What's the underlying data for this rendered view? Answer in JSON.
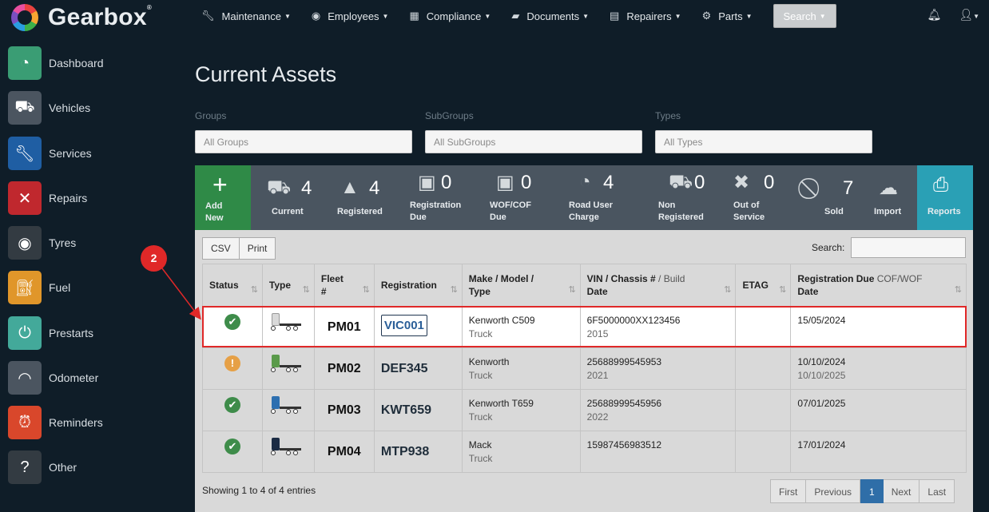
{
  "brand": {
    "name": "Gearbox"
  },
  "sidebar": {
    "items": [
      {
        "label": "Dashboard",
        "icon": "speedometer-icon",
        "color": "#3a9d74"
      },
      {
        "label": "Vehicles",
        "icon": "truck-icon",
        "color": "#4b5560"
      },
      {
        "label": "Services",
        "icon": "wrench-icon",
        "color": "#1f5ea3"
      },
      {
        "label": "Repairs",
        "icon": "tools-icon",
        "color": "#c0282e"
      },
      {
        "label": "Tyres",
        "icon": "tyre-icon",
        "color": "#333b42"
      },
      {
        "label": "Fuel",
        "icon": "fuel-pump-icon",
        "color": "#e0962a"
      },
      {
        "label": "Prestarts",
        "icon": "power-icon",
        "color": "#43a99a"
      },
      {
        "label": "Odometer",
        "icon": "gauge-icon",
        "color": "#4b5560"
      },
      {
        "label": "Reminders",
        "icon": "alarm-clock-icon",
        "color": "#d9472b"
      },
      {
        "label": "Other",
        "icon": "question-icon",
        "color": "#333b42"
      }
    ]
  },
  "topnav": {
    "menus": [
      {
        "label": "Maintenance",
        "icon": "wrench-icon"
      },
      {
        "label": "Employees",
        "icon": "user-circle-icon"
      },
      {
        "label": "Compliance",
        "icon": "calendar-icon"
      },
      {
        "label": "Documents",
        "icon": "folder-icon"
      },
      {
        "label": "Repairers",
        "icon": "address-book-icon"
      },
      {
        "label": "Parts",
        "icon": "gear-icon"
      }
    ],
    "search_label": "Search"
  },
  "page": {
    "title": "Current Assets"
  },
  "filters": [
    {
      "label": "Groups",
      "value": "All Groups"
    },
    {
      "label": "SubGroups",
      "value": "All SubGroups"
    },
    {
      "label": "Types",
      "value": "All Types"
    }
  ],
  "stats": {
    "add_label": "Add New",
    "items": [
      {
        "count": "4",
        "label": "Current"
      },
      {
        "count": "4",
        "label": "Registered"
      },
      {
        "count": "0",
        "label": "Registration Due"
      },
      {
        "count": "0",
        "label": "WOF/COF Due"
      },
      {
        "count": "4",
        "label": "Road User Charge"
      },
      {
        "count": "0",
        "label": "Non Registered"
      },
      {
        "count": "0",
        "label": "Out of Service"
      },
      {
        "count": "7",
        "label": "Sold"
      }
    ],
    "import_label": "Import",
    "reports_label": "Reports"
  },
  "table_tools": {
    "csv": "CSV",
    "print": "Print",
    "search_label": "Search:"
  },
  "table": {
    "headers": {
      "status": "Status",
      "type": "Type",
      "fleet": "Fleet #",
      "registration": "Registration",
      "make": "Make / Model / Type",
      "vin_a": "VIN / Chassis #",
      "vin_b": " / Build",
      "vin_c": "Date",
      "etag": "ETAG",
      "regdue_a": "Registration Due",
      "regdue_b": " COF/WOF",
      "regdue_c": "Date"
    },
    "rows": [
      {
        "status": "ok",
        "fleet": "PM01",
        "registration": "VIC001",
        "make": "Kenworth C509",
        "type": "Truck",
        "vin": "6F5000000XX123456",
        "build": "2015",
        "etag": "",
        "reg_due": "15/05/2024",
        "cof_due": "",
        "truck_color": "#d9d9d9"
      },
      {
        "status": "warn",
        "fleet": "PM02",
        "registration": "DEF345",
        "make": "Kenworth",
        "type": "Truck",
        "vin": "25688999545953",
        "build": "2021",
        "etag": "",
        "reg_due": "10/10/2024",
        "cof_due": "10/10/2025",
        "truck_color": "#5a9a4a"
      },
      {
        "status": "ok",
        "fleet": "PM03",
        "registration": "KWT659",
        "make": "Kenworth T659",
        "type": "Truck",
        "vin": "25688999545956",
        "build": "2022",
        "etag": "",
        "reg_due": "07/01/2025",
        "cof_due": "",
        "truck_color": "#2d6fb0"
      },
      {
        "status": "ok",
        "fleet": "PM04",
        "registration": "MTP938",
        "make": "Mack",
        "type": "Truck",
        "vin": "15987456983512",
        "build": "",
        "etag": "",
        "reg_due": "17/01/2024",
        "cof_due": "",
        "truck_color": "#1b2b44"
      }
    ]
  },
  "footer": {
    "info": "Showing 1 to 4 of 4 entries",
    "pager": {
      "first": "First",
      "previous": "Previous",
      "page": "1",
      "next": "Next",
      "last": "Last"
    }
  },
  "annotation": {
    "step": "2"
  }
}
